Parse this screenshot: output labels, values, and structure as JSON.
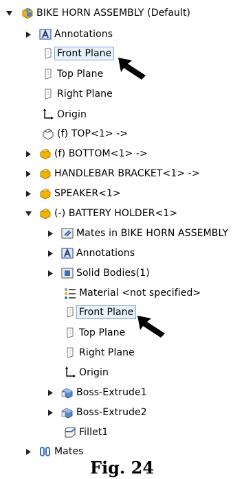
{
  "tree": {
    "root": {
      "label": "BIKE HORN ASSEMBLY  (Default)",
      "icon": "assembly-icon"
    },
    "items": [
      {
        "label": "Annotations",
        "icon": "annotations-icon"
      },
      {
        "label": "Front Plane",
        "icon": "plane-icon",
        "selected": true
      },
      {
        "label": "Top Plane",
        "icon": "plane-icon"
      },
      {
        "label": "Right Plane",
        "icon": "plane-icon"
      },
      {
        "label": "Origin",
        "icon": "origin-icon"
      },
      {
        "label": "(f) TOP<1> ->",
        "icon": "part-outline-icon"
      },
      {
        "label": "(f) BOTTOM<1> ->",
        "icon": "part-icon"
      },
      {
        "label": "HANDLEBAR BRACKET<1> ->",
        "icon": "part-icon"
      },
      {
        "label": "SPEAKER<1>",
        "icon": "part-icon"
      },
      {
        "label": "(-) BATTERY HOLDER<1>",
        "icon": "part-icon"
      }
    ],
    "battery_children": [
      {
        "label": "Mates in BIKE HORN ASSEMBLY",
        "icon": "mates-in-icon"
      },
      {
        "label": "Annotations",
        "icon": "annotations-icon"
      },
      {
        "label": "Solid Bodies(1)",
        "icon": "solid-bodies-icon"
      },
      {
        "label": "Material <not specified>",
        "icon": "material-icon"
      },
      {
        "label": "Front Plane",
        "icon": "plane-icon",
        "selected": true
      },
      {
        "label": "Top Plane",
        "icon": "plane-icon"
      },
      {
        "label": "Right Plane",
        "icon": "plane-icon"
      },
      {
        "label": "Origin",
        "icon": "origin-icon"
      },
      {
        "label": "Boss-Extrude1",
        "icon": "extrude-icon"
      },
      {
        "label": "Boss-Extrude2",
        "icon": "extrude-icon"
      },
      {
        "label": "Fillet1",
        "icon": "fillet-icon"
      }
    ],
    "mates": {
      "label": "Mates",
      "icon": "mates-icon"
    }
  },
  "caption": "Fig. 24",
  "colors": {
    "part_yellow": "#f0b400",
    "assembly_blue": "#5b7fc7",
    "selection_border": "#7fa8d6"
  }
}
